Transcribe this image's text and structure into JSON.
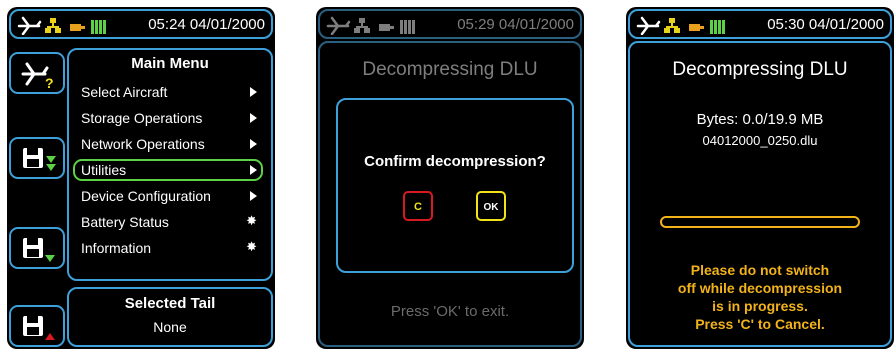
{
  "colors": {
    "accent": "#3ea0d8",
    "selected": "#5cd146",
    "warning": "#f2b21c",
    "cancel_red": "#d71920",
    "ok_yellow": "#f2e21c"
  },
  "screen1": {
    "status": {
      "time": "05:24 04/01/2000"
    },
    "side_buttons": [
      {
        "icon": "aircraft-help-icon"
      },
      {
        "icon": "disk-download-icon"
      },
      {
        "icon": "disk-green-down-icon"
      },
      {
        "icon": "disk-red-up-icon"
      }
    ],
    "menu": {
      "title": "Main Menu",
      "items": [
        {
          "label": "Select Aircraft",
          "marker": "arrow"
        },
        {
          "label": "Storage Operations",
          "marker": "arrow"
        },
        {
          "label": "Network Operations",
          "marker": "arrow"
        },
        {
          "label": "Utilities",
          "marker": "arrow",
          "selected": true
        },
        {
          "label": "Device Configuration",
          "marker": "arrow"
        },
        {
          "label": "Battery Status",
          "marker": "gear"
        },
        {
          "label": "Information",
          "marker": "gear"
        }
      ]
    },
    "tail": {
      "title": "Selected Tail",
      "value": "None"
    }
  },
  "screen2": {
    "status": {
      "time": "05:29 04/01/2000"
    },
    "title": "Decompressing DLU",
    "dialog": {
      "question": "Confirm decompression?",
      "cancel_label": "C",
      "ok_label": "OK"
    },
    "footer": "Press 'OK' to exit."
  },
  "screen3": {
    "status": {
      "time": "05:30 04/01/2000"
    },
    "title": "Decompressing DLU",
    "bytes": "Bytes: 0.0/19.9 MB",
    "filename": "04012000_0250.dlu",
    "progress": 0.0,
    "warning_lines": [
      "Please do not switch",
      "off while decompression",
      "is in progress.",
      "Press 'C' to Cancel."
    ]
  }
}
